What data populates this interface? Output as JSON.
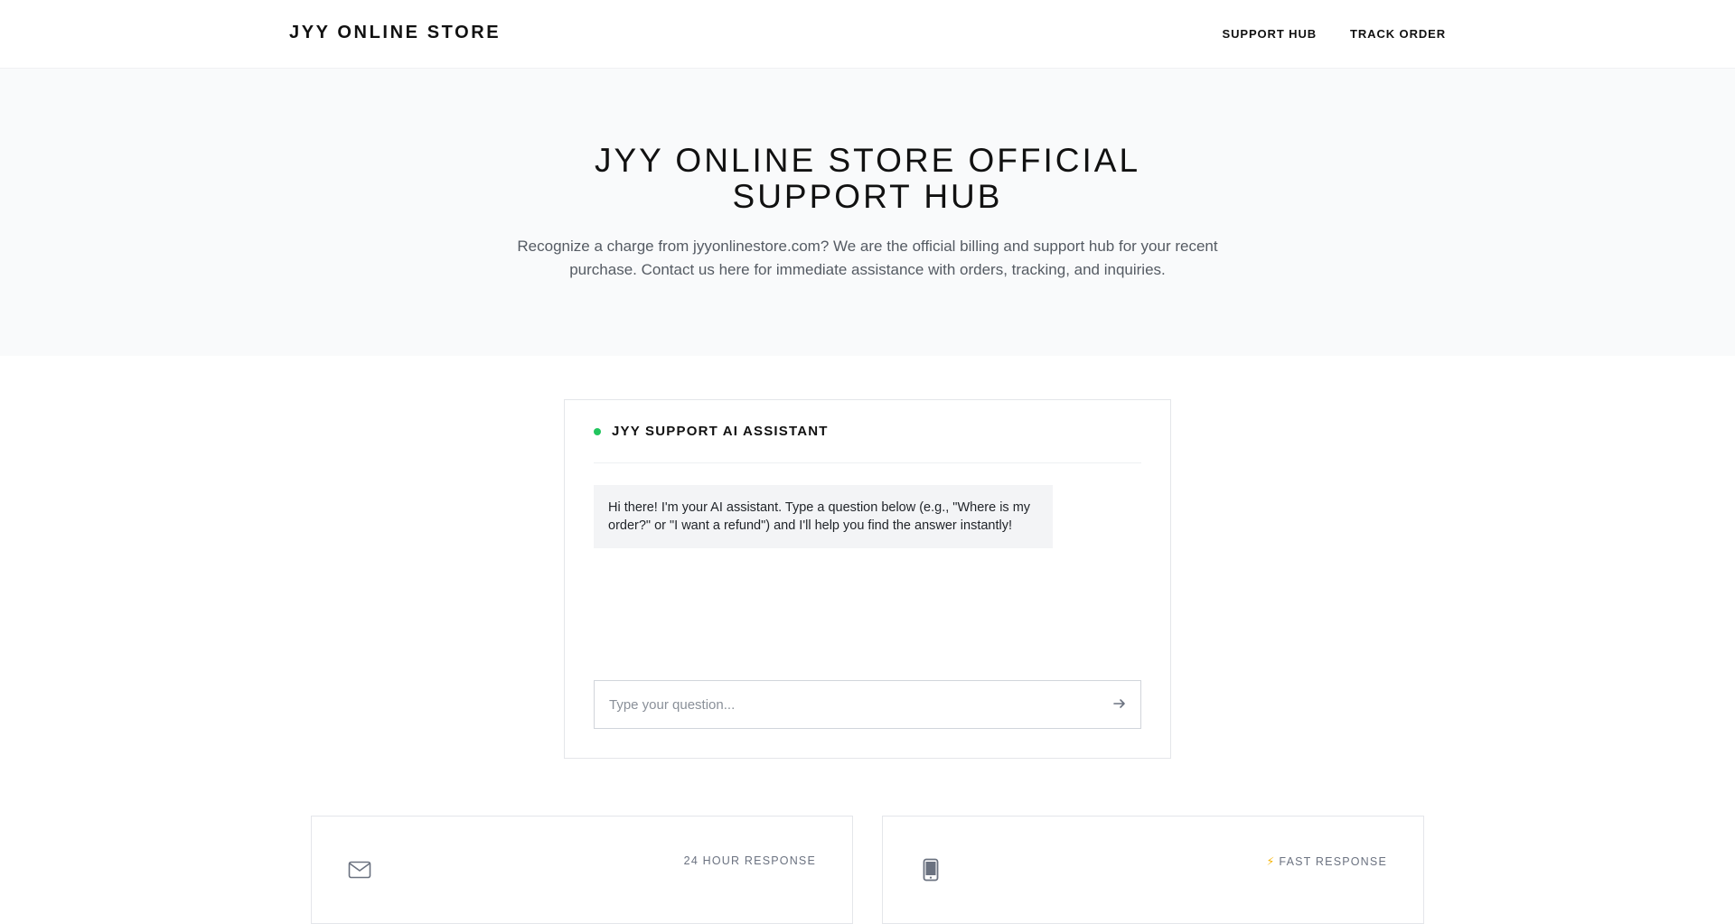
{
  "header": {
    "brand": "JYY ONLINE STORE",
    "nav": [
      {
        "label": "SUPPORT HUB"
      },
      {
        "label": "TRACK ORDER"
      }
    ]
  },
  "hero": {
    "title": "JYY ONLINE STORE OFFICIAL SUPPORT HUB",
    "subtitle": "Recognize a charge from jyyonlinestore.com? We are the official billing and support hub for your recent purchase. Contact us here for immediate assistance with orders, tracking, and inquiries."
  },
  "chat": {
    "title": "JYY SUPPORT AI ASSISTANT",
    "status_color": "#22c55e",
    "greeting": "Hi there! I'm your AI assistant. Type a question below (e.g., \"Where is my order?\" or \"I want a refund\") and I'll help you find the answer instantly!",
    "input_value": "",
    "input_placeholder": "Type your question...",
    "send_icon": "arrow-right-icon"
  },
  "features": [
    {
      "icon": "mail-icon",
      "tag": "24 HOUR RESPONSE"
    },
    {
      "icon": "smartphone-icon",
      "tag_icon": "lightning-icon",
      "tag_glyph": "⚡",
      "tag": "FAST RESPONSE"
    }
  ]
}
